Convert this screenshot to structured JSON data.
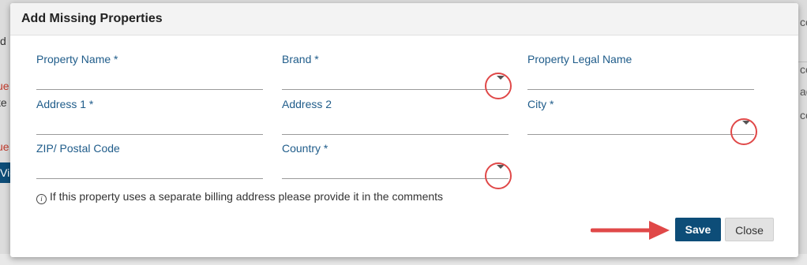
{
  "background": {
    "left_fragment_1": "d",
    "left_fragment_red_1": "ue",
    "left_fragment_2": "te",
    "left_fragment_red_2": "ue",
    "left_button_fragment": "Vie",
    "right_fragment_1": "co",
    "right_fragment_2": "co",
    "right_fragment_3": "ad",
    "right_fragment_4": "co"
  },
  "dialog": {
    "title": "Add Missing Properties",
    "fields": {
      "property_name": {
        "label": "Property Name *",
        "value": ""
      },
      "brand": {
        "label": "Brand *",
        "value": ""
      },
      "property_legal_name": {
        "label": "Property Legal Name",
        "value": ""
      },
      "address1": {
        "label": "Address 1 *",
        "value": ""
      },
      "address2": {
        "label": "Address 2",
        "value": ""
      },
      "city": {
        "label": "City *",
        "value": ""
      },
      "zip": {
        "label": "ZIP/ Postal Code",
        "value": ""
      },
      "country": {
        "label": "Country *",
        "value": ""
      }
    },
    "note_icon": "i",
    "note": "If this property uses a separate billing address please provide it in the comments",
    "buttons": {
      "save": "Save",
      "close": "Close"
    }
  },
  "colors": {
    "accent": "#0d4d78",
    "label": "#1f5c8a",
    "annotation": "#e04848"
  },
  "icons": {
    "dropdown": "caret-down-icon",
    "info": "info-icon",
    "annotation_arrow": "red-arrow-icon"
  }
}
